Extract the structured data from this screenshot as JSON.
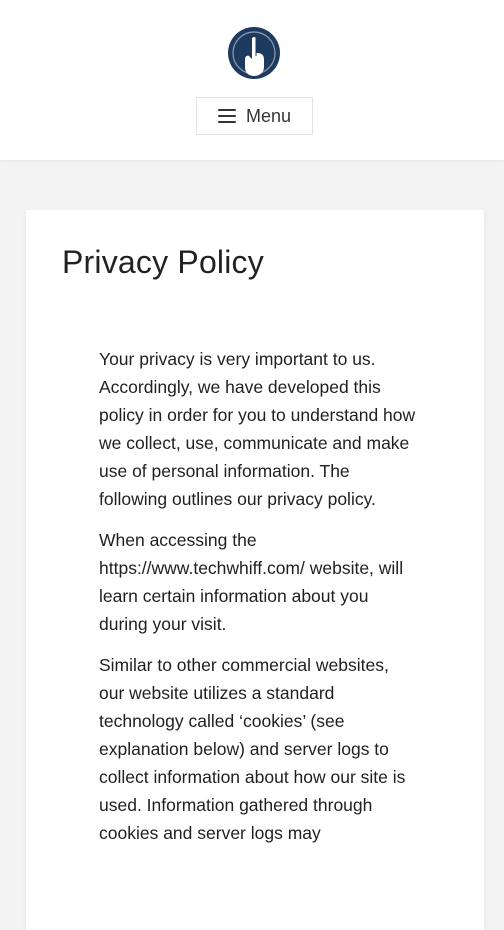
{
  "header": {
    "logo": {
      "icon": "hand-pointer-icon",
      "color": "#1f3a5f"
    },
    "menu": {
      "icon": "hamburger-icon",
      "label": "Menu"
    }
  },
  "page": {
    "title": "Privacy Policy",
    "paragraphs": [
      "Your privacy is very important to us. Accordingly, we have developed this policy in order for you to understand how we collect, use, communicate and make use of personal information. The following outlines our privacy policy.",
      "When accessing the https://www.techwhiff.com/ website, will learn certain information about you during your visit.",
      "Similar to other commercial websites, our website utilizes a standard technology called ‘cookies’ (see explanation below) and server logs to collect information about how our site is used. Information gathered through cookies and server logs may"
    ]
  }
}
